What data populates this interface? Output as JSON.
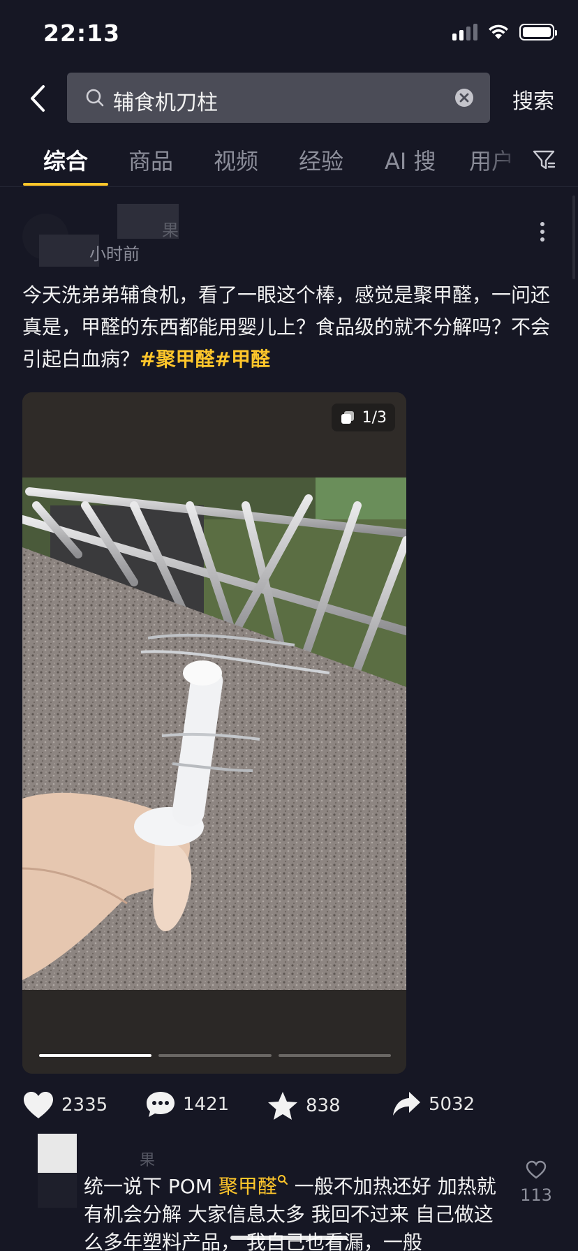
{
  "status_bar": {
    "time": "22:13"
  },
  "search": {
    "query": "辅食机刀柱",
    "submit_label": "搜索"
  },
  "tabs": [
    {
      "label": "综合",
      "active": true
    },
    {
      "label": "商品"
    },
    {
      "label": "视频"
    },
    {
      "label": "经验"
    },
    {
      "label": "AI 搜"
    },
    {
      "label": "用户"
    }
  ],
  "post": {
    "author_name": "果",
    "time_ago": "小时前",
    "text": "今天洗弟弟辅食机，看了一眼这个棒，感觉是聚甲醛，一问还真是，甲醛的东西都能用婴儿上？食品级的就不分解吗？不会引起白血病？",
    "hashtags": "#聚甲醛#甲醛",
    "media": {
      "counter": "1/3",
      "current_index": 1,
      "total": 3
    },
    "stats": {
      "likes": "2335",
      "comments": "1421",
      "favorites": "838",
      "shares": "5032"
    }
  },
  "comment": {
    "author_name": "果",
    "text_before": "统一说下 POM ",
    "keyword": "聚甲醛",
    "text_after": " 一般不加热还好 加热就有机会分解 大家信息太多 我回不过来 自己做这么多年塑料产品， 我自己也看漏，一般",
    "like_count": "113"
  },
  "colors": {
    "background": "#161724",
    "accent": "#ffc62b",
    "search_box": "#4b4c57",
    "muted_text": "#8c8e9a"
  }
}
